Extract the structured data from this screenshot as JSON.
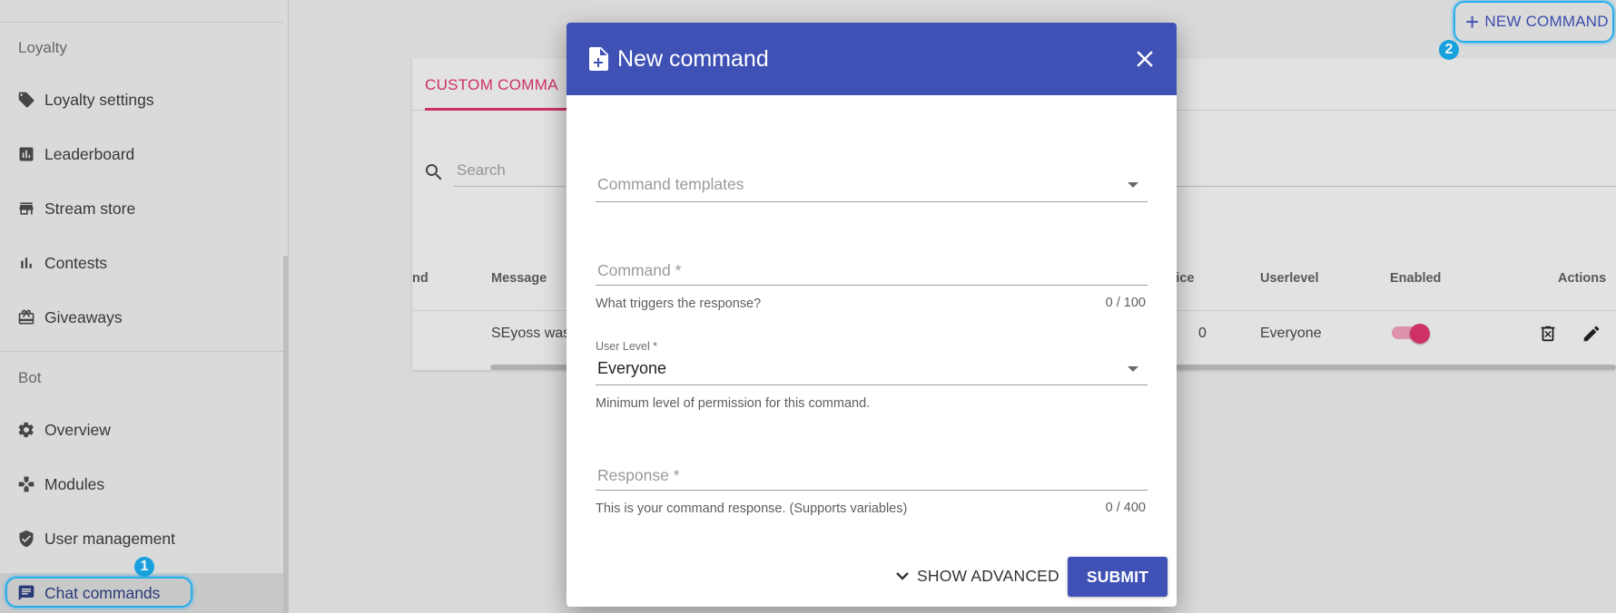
{
  "sidebar": {
    "sections": [
      "Loyalty",
      "Bot"
    ],
    "items": [
      {
        "label": "Loyalty settings",
        "icon": "tag-icon"
      },
      {
        "label": "Leaderboard",
        "icon": "bar-chart-icon"
      },
      {
        "label": "Stream store",
        "icon": "store-icon"
      },
      {
        "label": "Contests",
        "icon": "poll-icon"
      },
      {
        "label": "Giveaways",
        "icon": "gift-icon"
      },
      {
        "label": "Overview",
        "icon": "gear-icon"
      },
      {
        "label": "Modules",
        "icon": "modules-icon"
      },
      {
        "label": "User management",
        "icon": "shield-icon"
      },
      {
        "label": "Chat commands",
        "icon": "chat-icon",
        "active": true
      }
    ]
  },
  "markers": {
    "one": "1",
    "two": "2"
  },
  "header": {
    "new_command_label": "NEW COMMAND"
  },
  "tabs": {
    "custom": "CUSTOM COMMA"
  },
  "search": {
    "placeholder": "Search"
  },
  "table": {
    "headers": [
      "nd",
      "Message",
      "Price",
      "Userlevel",
      "Enabled",
      "Actions"
    ],
    "row": {
      "message": "SEyoss was",
      "price": "0",
      "userlevel": "Everyone",
      "enabled": true
    }
  },
  "dialog": {
    "title": "New command",
    "templates_placeholder": "Command templates",
    "command_placeholder": "Command *",
    "command_hint": "What triggers the response?",
    "command_count": "0 / 100",
    "userlevel_label": "User Level *",
    "userlevel_value": "Everyone",
    "userlevel_hint": "Minimum level of permission for this command.",
    "response_placeholder": "Response *",
    "response_hint": "This is your command response. (Supports variables)",
    "response_count": "0 / 400",
    "show_advanced": "SHOW ADVANCED",
    "submit": "SUBMIT"
  },
  "colors": {
    "primary": "#3f51b5",
    "accent": "#d6336c",
    "highlight": "#29b6f6"
  }
}
